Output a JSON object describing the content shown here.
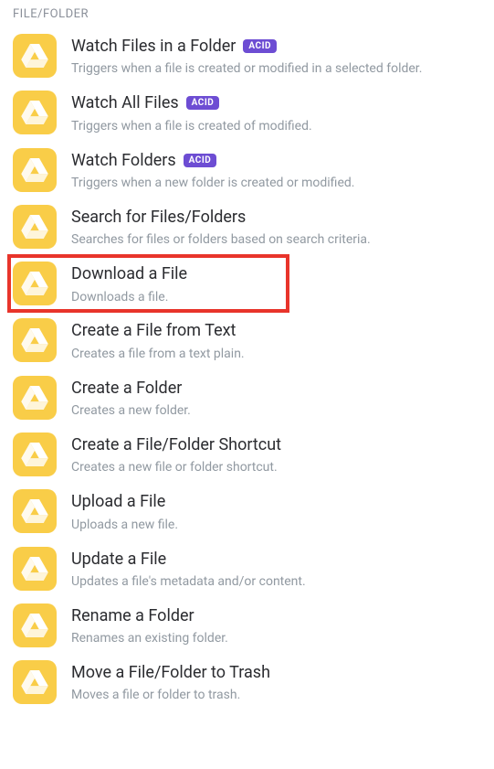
{
  "section": {
    "header": "FILE/FOLDER"
  },
  "badge_text": "ACID",
  "items": [
    {
      "title": "Watch Files in a Folder",
      "desc": "Triggers when a file is created or modified in a selected folder.",
      "acid": true,
      "highlighted": false
    },
    {
      "title": "Watch All Files",
      "desc": "Triggers when a file is created of modified.",
      "acid": true,
      "highlighted": false
    },
    {
      "title": "Watch Folders",
      "desc": "Triggers when a new folder is created or modified.",
      "acid": true,
      "highlighted": false
    },
    {
      "title": "Search for Files/Folders",
      "desc": "Searches for files or folders based on search criteria.",
      "acid": false,
      "highlighted": false
    },
    {
      "title": "Download a File",
      "desc": "Downloads a file.",
      "acid": false,
      "highlighted": true
    },
    {
      "title": "Create a File from Text",
      "desc": "Creates a file from a text plain.",
      "acid": false,
      "highlighted": false
    },
    {
      "title": "Create a Folder",
      "desc": "Creates a new folder.",
      "acid": false,
      "highlighted": false
    },
    {
      "title": "Create a File/Folder Shortcut",
      "desc": "Creates a new file or folder shortcut.",
      "acid": false,
      "highlighted": false
    },
    {
      "title": "Upload a File",
      "desc": "Uploads a new file.",
      "acid": false,
      "highlighted": false
    },
    {
      "title": "Update a File",
      "desc": "Updates a file's metadata and/or content.",
      "acid": false,
      "highlighted": false
    },
    {
      "title": "Rename a Folder",
      "desc": "Renames an existing folder.",
      "acid": false,
      "highlighted": false
    },
    {
      "title": "Move a File/Folder to Trash",
      "desc": "Moves a file or folder to trash.",
      "acid": false,
      "highlighted": false
    }
  ]
}
